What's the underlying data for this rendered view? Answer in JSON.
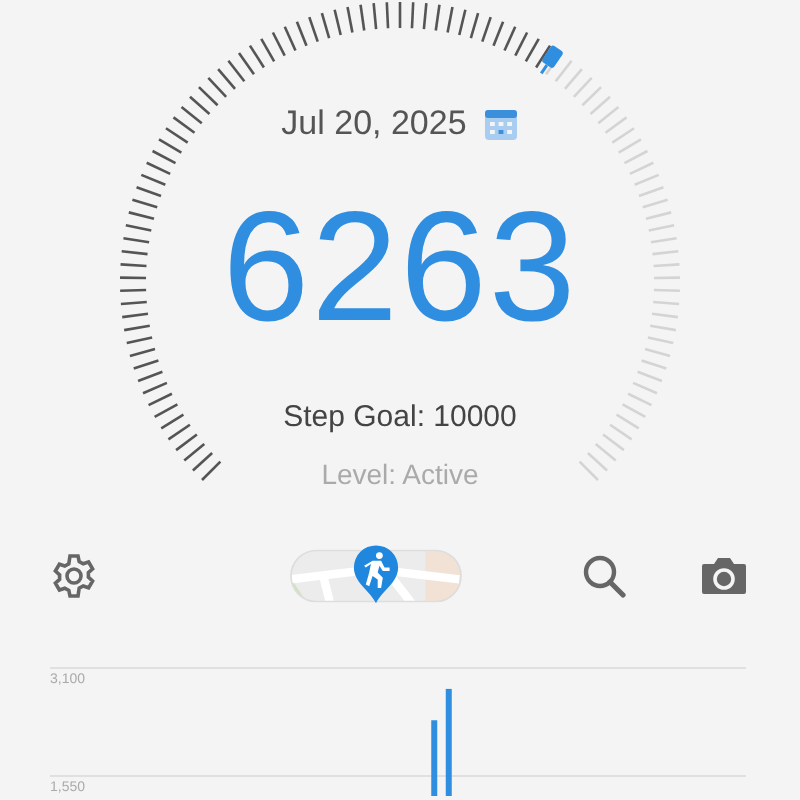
{
  "date": "Jul 20, 2025",
  "steps": "6263",
  "goal_label": "Step Goal: 10000",
  "level_label": "Level: Active",
  "activity_chart": {
    "chart_data": {
      "type": "bar",
      "ylim": [
        0,
        3100
      ],
      "yticks": [
        {
          "value": 1550,
          "label": "1,550"
        },
        {
          "value": 3100,
          "label": "3,100"
        }
      ],
      "values": [
        null,
        null,
        null,
        null,
        null,
        null,
        null,
        null,
        null,
        null,
        null,
        null,
        null,
        null,
        null,
        null,
        null,
        null,
        null,
        null,
        null,
        null,
        null,
        null,
        null,
        null,
        2350,
        2800,
        null,
        null,
        null,
        null,
        null,
        null,
        null,
        null,
        null,
        null,
        null,
        null,
        null,
        null,
        null,
        null,
        null,
        null,
        null,
        null
      ]
    }
  }
}
